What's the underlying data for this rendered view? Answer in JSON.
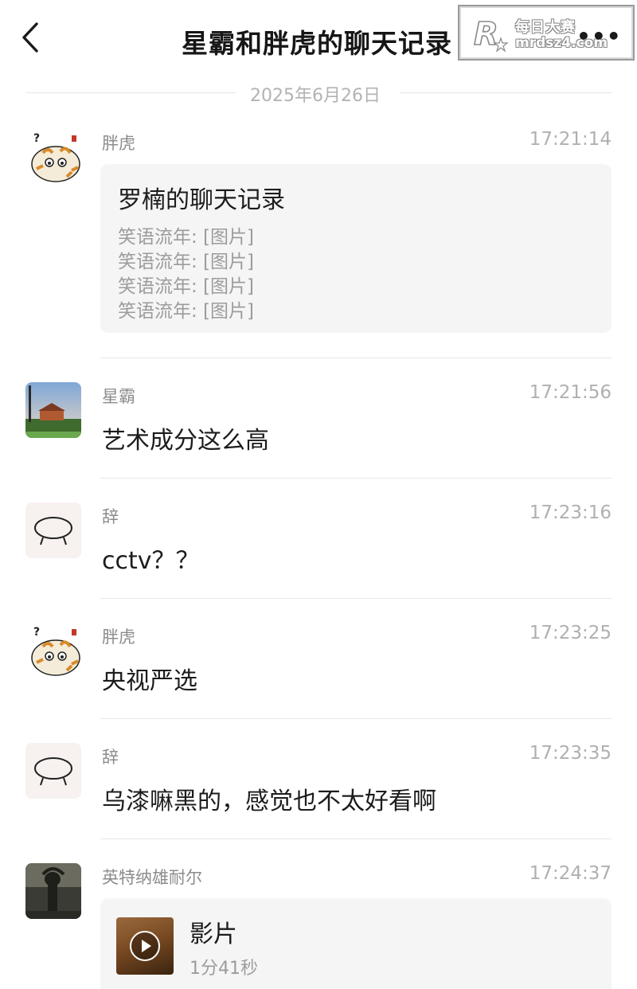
{
  "header": {
    "title": "星霸和胖虎的聊天记录",
    "watermark_line1": "每日大赛",
    "watermark_line2": "mrdsz4.com",
    "more_label": "•••"
  },
  "date_separator": "2025年6月26日",
  "messages": [
    {
      "sender": "胖虎",
      "time": "17:21:14",
      "avatar": "tiger-avatar",
      "card": {
        "title": "罗楠的聊天记录",
        "lines": [
          "笑语流年: [图片]",
          "笑语流年: [图片]",
          "笑语流年: [图片]",
          "笑语流年: [图片]"
        ]
      }
    },
    {
      "sender": "星霸",
      "time": "17:21:56",
      "avatar": "landscape-avatar",
      "text": "艺术成分这么高"
    },
    {
      "sender": "辞",
      "time": "17:23:16",
      "avatar": "doodle-avatar",
      "text": "cctv？？"
    },
    {
      "sender": "胖虎",
      "time": "17:23:25",
      "avatar": "tiger-avatar",
      "text": "央视严选"
    },
    {
      "sender": "辞",
      "time": "17:23:35",
      "avatar": "doodle-avatar",
      "text": "乌漆嘛黑的，感觉也不太好看啊"
    },
    {
      "sender": "英特纳雄耐尔",
      "time": "17:24:37",
      "avatar": "dark-figure-avatar",
      "video": {
        "title": "影片",
        "duration": "1分41秒"
      }
    }
  ],
  "colors": {
    "accent_text": "#1c1c1c",
    "muted_text": "#9c9c9c",
    "card_bg": "#f5f5f5",
    "divider": "#e8e8e8"
  }
}
